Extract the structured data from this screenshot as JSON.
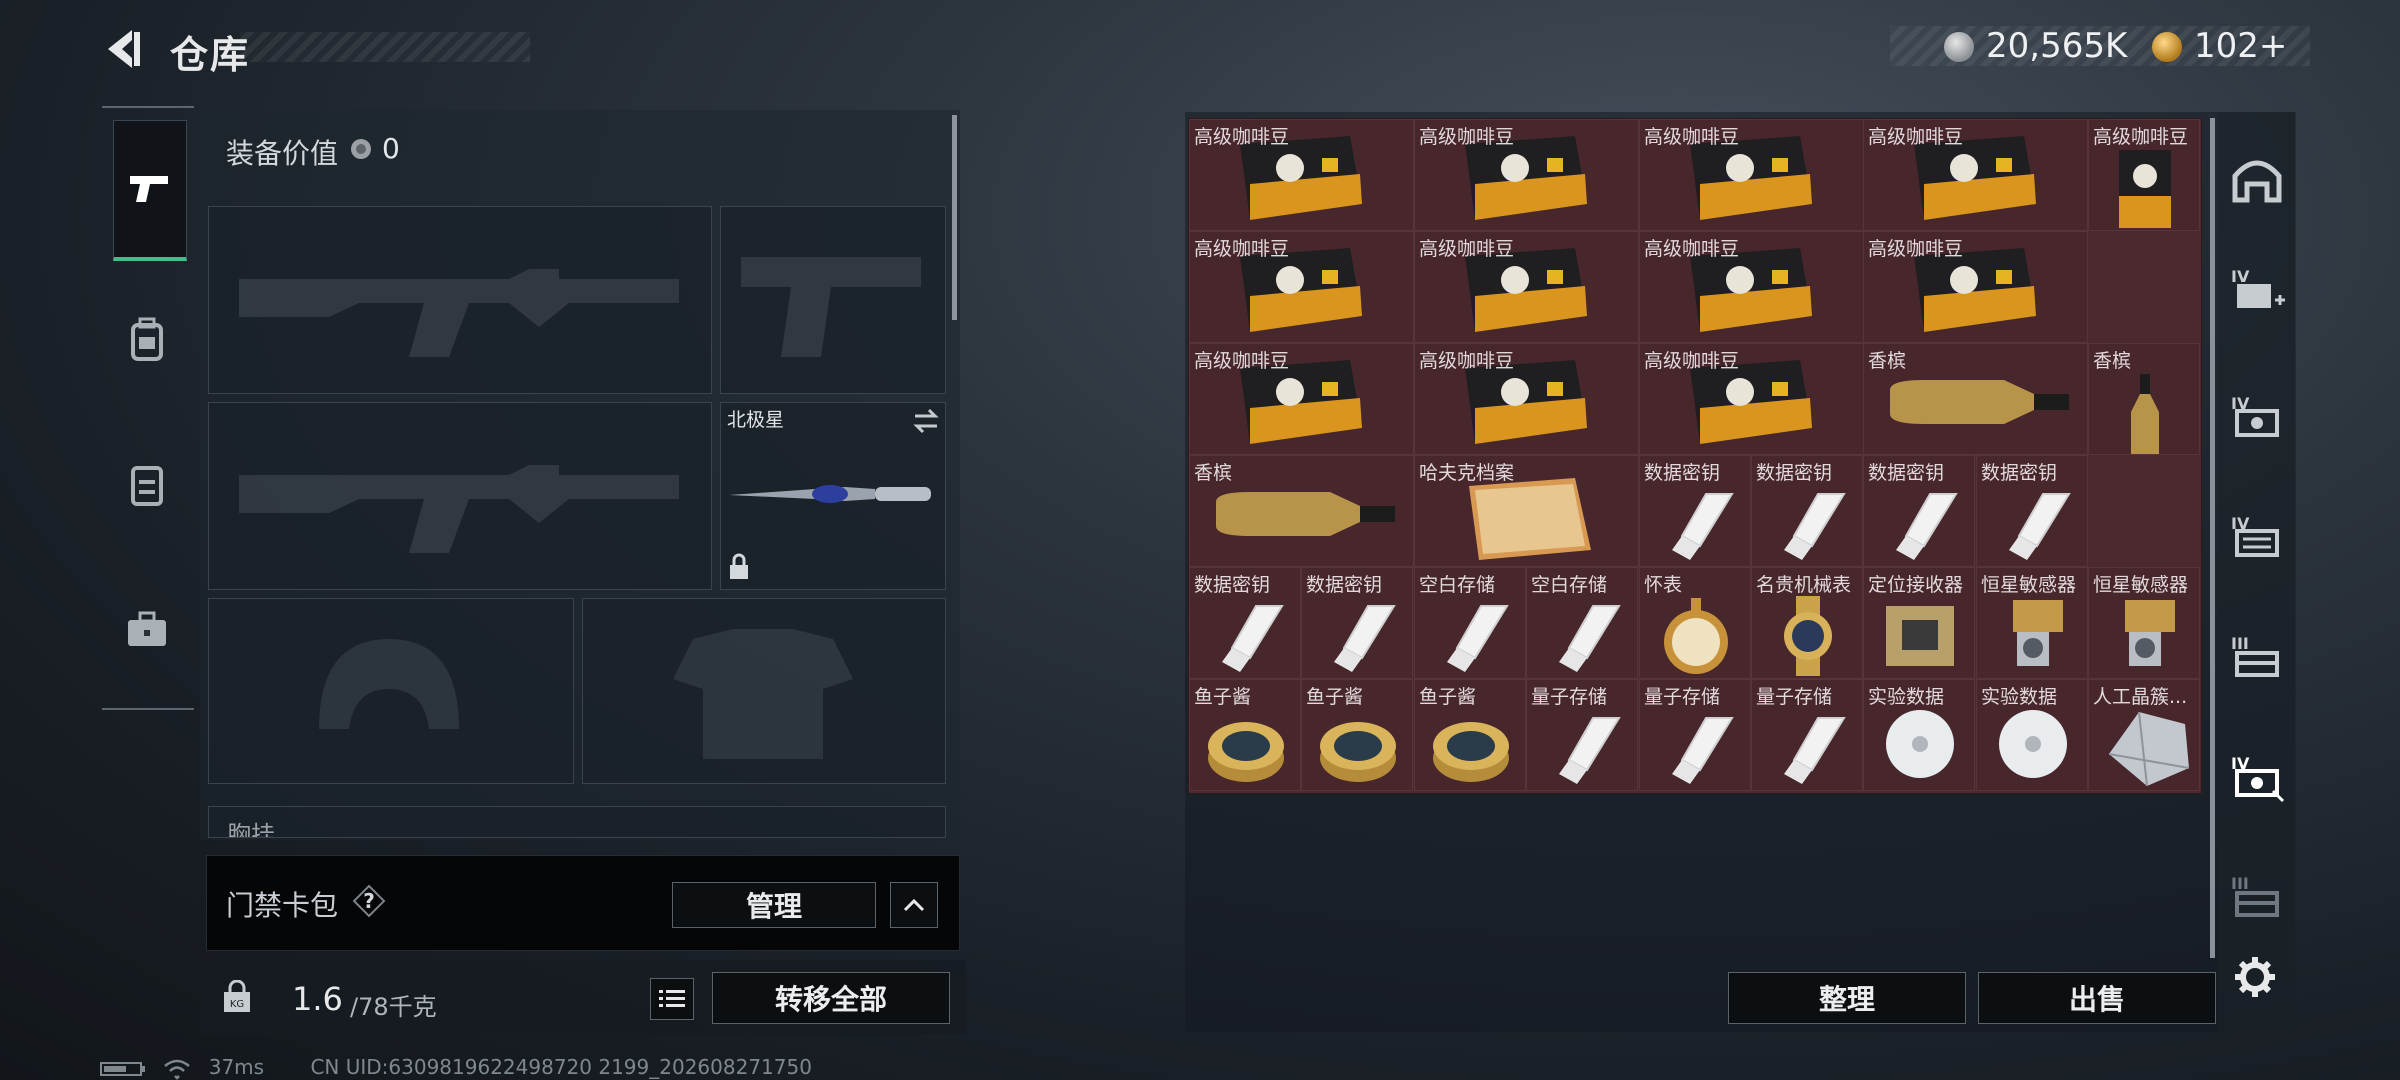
{
  "header": {
    "title": "仓库",
    "currency_silver": "20,565K",
    "currency_gold": "102+"
  },
  "equipment": {
    "value_label": "装备价值",
    "value": "0",
    "melee_slot_name": "北极星",
    "chest_rig_label": "胸挂"
  },
  "keycard": {
    "label": "门禁卡包",
    "manage_label": "管理"
  },
  "capacity": {
    "current": "1.6",
    "max": "/78千克",
    "transfer_all_label": "转移全部"
  },
  "stash": {
    "organize_label": "整理",
    "sell_label": "出售",
    "items": [
      "高级咖啡豆",
      "高级咖啡豆",
      "高级咖啡豆",
      "高级咖啡豆",
      "高级咖啡豆",
      "高级咖啡豆",
      "高级咖啡豆",
      "高级咖啡豆",
      "高级咖啡豆",
      "高级咖啡豆",
      "高级咖啡豆",
      "高级咖啡豆",
      "香槟",
      "香槟",
      "香槟",
      "哈夫克档案",
      "数据密钥",
      "数据密钥",
      "数据密钥",
      "数据密钥",
      "数据密钥",
      "数据密钥",
      "空白存储",
      "空白存储",
      "怀表",
      "名贵机械表",
      "定位接收器",
      "恒星敏感器",
      "恒星敏感器",
      "鱼子酱",
      "鱼子酱",
      "鱼子酱",
      "量子存储",
      "量子存储",
      "量子存储",
      "实验数据",
      "实验数据",
      "人工晶簇..."
    ]
  },
  "right_rail": {
    "tiers": [
      "IV",
      "IV",
      "IV",
      "III",
      "IV",
      "III"
    ]
  },
  "status": {
    "ping": "37ms",
    "uid": "CN UID:6309819622498720 2199_202608271750"
  }
}
